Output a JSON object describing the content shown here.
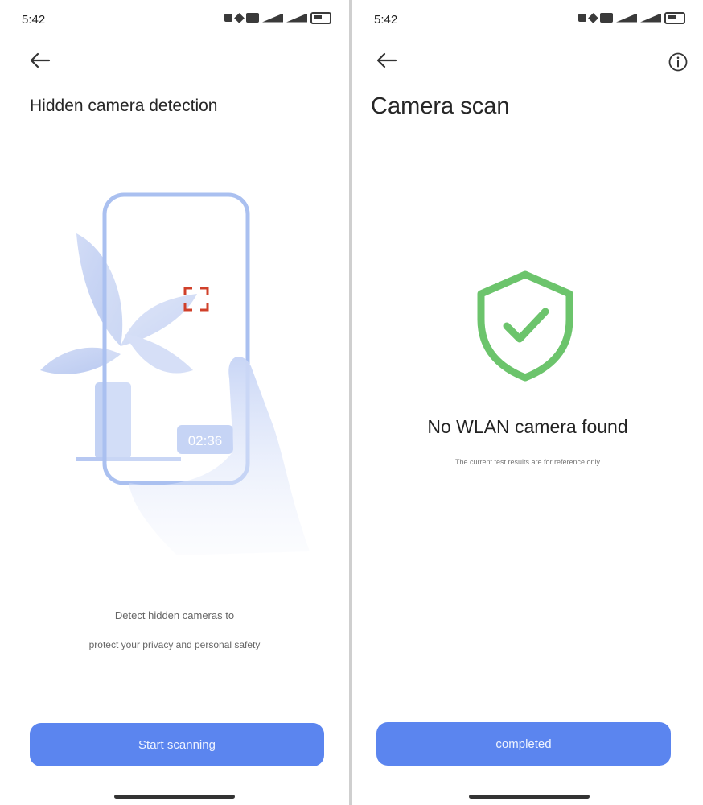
{
  "status_bar": {
    "time": "5:42"
  },
  "detection_screen": {
    "title": "Hidden camera detection",
    "timer_text": "02:36",
    "description_line_1": "Detect hidden cameras to",
    "description_line_2": "protect your privacy and personal safety",
    "start_button_label": "Start scanning"
  },
  "scan_screen": {
    "title": "Camera scan",
    "result_title": "No WLAN camera found",
    "result_note": "The current test results are for reference only",
    "completed_button_label": "completed"
  },
  "colors": {
    "accent_button": "#5b85ef",
    "shield_green": "#6cc46c",
    "illustration_blue": "#b7c8f2",
    "focus_bracket": "#d0402a"
  },
  "icons": [
    "back-arrow-icon",
    "info-icon",
    "shield-check-icon"
  ]
}
